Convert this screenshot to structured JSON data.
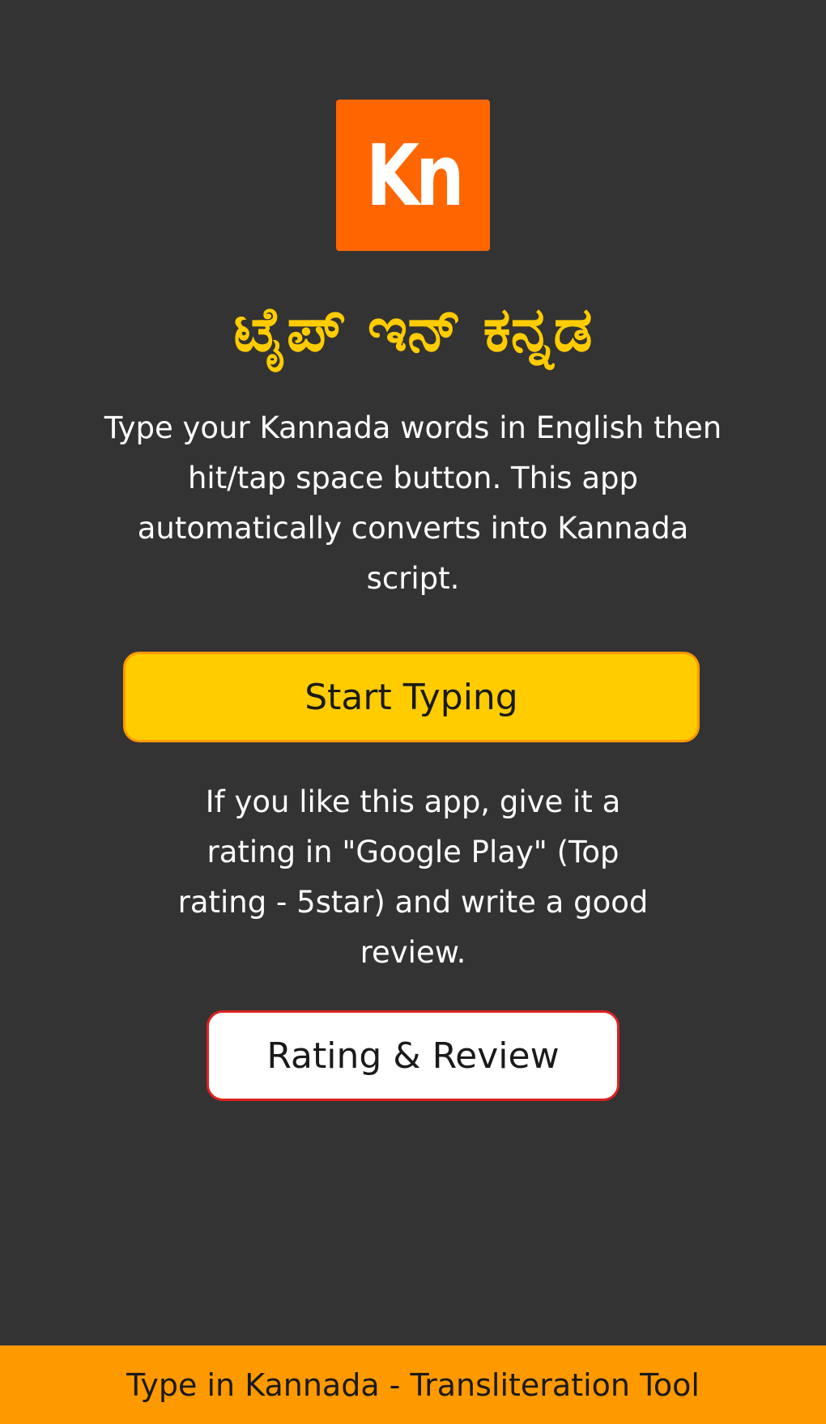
{
  "app": {
    "logo_text": "Kn",
    "title": "ಟೈಪ್ ಇನ್ ಕನ್ನಡ",
    "intro_text": "Type your Kannada words in English then hit/tap space button. This app automatically converts into Kannada script."
  },
  "actions": {
    "start_label": "Start Typing",
    "rating_text": "If you like this app, give it a rating in \"Google Play\" (Top rating - 5star) and write a good review.",
    "rating_label": "Rating & Review"
  },
  "footer": {
    "text": "Type in Kannada - Transliteration Tool"
  },
  "colors": {
    "background": "#333333",
    "logo": "#ff6600",
    "title": "#ffcc00",
    "start_button": "#ffcc00",
    "rating_button_border": "#dd2222",
    "footer": "#ff9900"
  }
}
